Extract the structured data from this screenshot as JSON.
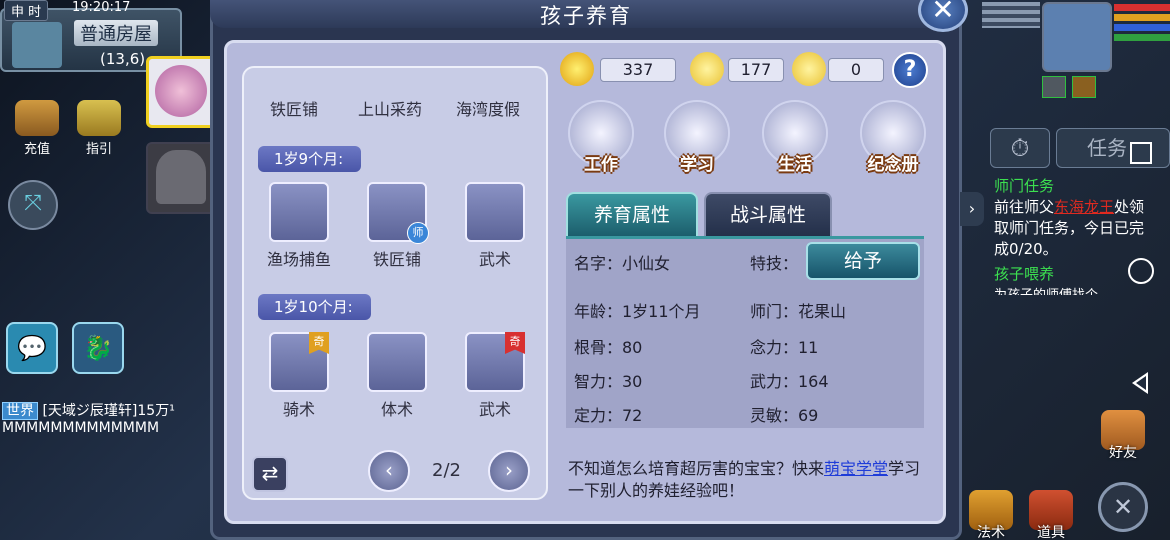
{
  "status": {
    "shichen": "申 时",
    "time": "19:20:17"
  },
  "location": {
    "name": "普通房屋",
    "coords": "(13,6)"
  },
  "left_menu": {
    "recharge": "充值",
    "guide": "指引"
  },
  "chat": {
    "channel": "世界",
    "line1": "[天域ジ辰瑾轩]15万¹",
    "line2": "MMMMMMMMMMMMM"
  },
  "dialog": {
    "title": "孩子养育",
    "close": "✕",
    "currency": [
      {
        "icon": "coin-icon",
        "value": "337"
      },
      {
        "icon": "mood-face-icon",
        "value": "177"
      },
      {
        "icon": "tired-face-icon",
        "value": "0"
      }
    ],
    "help": "?",
    "actions": [
      "工作",
      "学习",
      "生活",
      "纪念册"
    ],
    "top_tabs": [
      "铁匠铺",
      "上山采药",
      "海湾度假"
    ],
    "age_groups": [
      {
        "label": "1岁9个月:",
        "skills": [
          {
            "name": "渔场捕鱼",
            "badge": ""
          },
          {
            "name": "铁匠铺",
            "badge": "师"
          },
          {
            "name": "武术",
            "badge": ""
          }
        ]
      },
      {
        "label": "1岁10个月:",
        "skills": [
          {
            "name": "骑术",
            "badge": "奇"
          },
          {
            "name": "体术",
            "badge": ""
          },
          {
            "name": "武术",
            "badge": "奇"
          }
        ]
      }
    ],
    "pager": {
      "current": "2/2",
      "prev": "‹",
      "next": "›",
      "swap": "⇄"
    },
    "attr_tabs": [
      "养育属性",
      "战斗属性"
    ],
    "give_button": "给予",
    "attrs": {
      "name": "名字：小仙女",
      "skill": "特技：",
      "age": "年龄：1岁11个月",
      "master": "师门：花果山",
      "root": "根骨：80",
      "focus": "念力：11",
      "wisdom": "智力：30",
      "force": "武力：164",
      "calm": "定力：72",
      "agility": "灵敏：69"
    },
    "tip": {
      "pre": "不知道怎么培育超厉害的宝宝？快来",
      "link": "萌宝学堂",
      "post": "学习一下别人的养娃经验吧！"
    }
  },
  "quest": {
    "tab_label": "任务",
    "title1": "师门任务",
    "line1_pre": "前往师父",
    "line1_name": "东海龙王",
    "line1_post": "处领取师门任务，今日已完成0/20。",
    "title2": "孩子喂养",
    "line2": "为孩子的师傅找个..."
  },
  "bottom_right": {
    "friends": "好友",
    "spells": "法术",
    "items": "道具",
    "close": "✕"
  },
  "colors": {
    "accent_teal": "#2c7c8c",
    "link_blue": "#1f3cd8",
    "quest_green": "#3ce050",
    "quest_red": "#e02a20"
  }
}
